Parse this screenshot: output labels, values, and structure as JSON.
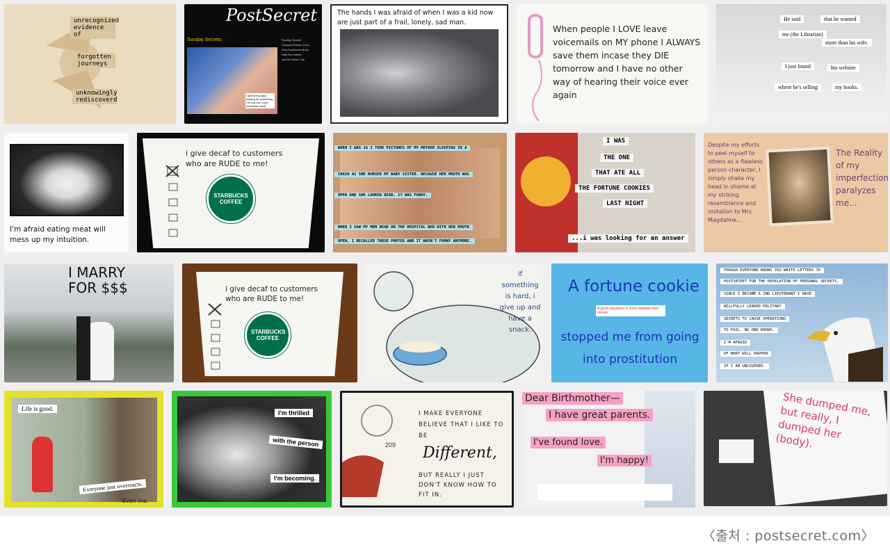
{
  "gallery": {
    "cards": [
      {
        "id": 1,
        "texts": [
          "unrecognized evidence of",
          "forgotten journeys",
          "unknowingly rediscoverd"
        ]
      },
      {
        "id": 2,
        "title": "PostSecret",
        "subtitle": "Sunday Secrets",
        "side_links": [
          "Sunday Secrets",
          "Campus Events (Tour)",
          "New PostSecret Book",
          "Help the Hotline",
          "1st the Hotline Life"
        ],
        "photo_note": "I spend my days looking for something I've lost but I can't remember what"
      },
      {
        "id": 3,
        "text": "The hands I was afraid of when I was a kid now are just part of a frail, lonely, sad man."
      },
      {
        "id": 4,
        "text": "When people I LOVE leave voicemails on MY phone I ALWAYS save them incase they DIE tomorrow and I have no other way of hearing their voice ever again"
      },
      {
        "id": 5,
        "texts": [
          "He said",
          "that he wanted",
          "me (the Librarian)",
          "more than his wife.",
          "I just found",
          "his website",
          "where he's selling",
          "my books."
        ]
      },
      {
        "id": 6,
        "text": "I'm afraid eating meat will mess up my intuition."
      },
      {
        "id": 7,
        "text": "i give decaf to customers who are RUDE to me!",
        "logo": "STARBUCKS COFFEE"
      },
      {
        "id": 8,
        "texts": [
          "WHEN I WAS 16 I TOOK PICTURES OF MY MOTHER SLEEPING IN A",
          "CHAIR AS SHE NURSED MY BABY SISTER. BECAUSE HER MOUTH WAS",
          "OPEN AND SHE LOOKED DEAD, IT WAS FUNNY.",
          "WHEN I SAW MY MOM DEAD ON THE HOSPITAL BED WITH HER MOUTH",
          "OPEN, I RECALLED THOSE PHOTOS AND IT WASN'T FUNNY ANYMORE."
        ]
      },
      {
        "id": 9,
        "texts": [
          "I WAS",
          "THE ONE",
          "THAT ATE ALL",
          "THE FORTUNE COOKIES",
          "LAST NIGHT",
          "...i was looking for an answer"
        ]
      },
      {
        "id": 10,
        "text": "Despite my efforts to peel myself to others as a flawless person character, I simply shake my head in shame at my striking resemblance and imitation to Mrs Magdaline...",
        "side": "The Reality of my imperfection paralyzes me..."
      },
      {
        "id": 11,
        "text": "I MARRY FOR $$$"
      },
      {
        "id": 12,
        "text": "i give decaf to customers who are RUDE to me!",
        "logo": "STARBUCKS COFFEE"
      },
      {
        "id": 13,
        "text": "if something is hard, i give up and have a snack."
      },
      {
        "id": 14,
        "line1": "A fortune cookie",
        "line2": "stopped me from going into prostitution",
        "slip": "A good reputation is more valuable than money"
      },
      {
        "id": 15,
        "texts": [
          "THOUGH EVERYONE KNOWS YOU WRITE LETTERS TO",
          "POSTSECRET FOR THE REVELATION OF PERSONAL SECRETS,",
          "SINCE I BECAME A 2ND LIEUTENANT I HAVE",
          "WILLFULLY LEAKED MILITARY",
          "SECRETS TO CAUSE OPERATIONS",
          "TO FAIL. NO ONE KNOWS.",
          "I'M AFRAID",
          "OF WHAT WILL HAPPEN",
          "IF I AM UNCOVERED."
        ]
      },
      {
        "id": 16,
        "texts": [
          "Life is good.",
          "Everyone just overreacts.",
          "Even me."
        ]
      },
      {
        "id": 17,
        "texts": [
          "I'm thrilled",
          "with the person",
          "I'm becoming."
        ]
      },
      {
        "id": 18,
        "text": "I MAKE EVERYONE BELIEVE THAT I LIKE TO BE",
        "big": "Different,",
        "text2": "BUT REALLY I JUST DON'T KNOW HOW TO FIT IN.",
        "stamp": "209"
      },
      {
        "id": 19,
        "texts": [
          "Dear Birthmother—",
          "I have great parents.",
          "I've found love.",
          "I'm happy!"
        ]
      },
      {
        "id": 20,
        "text": "She dumped me, but really, I dumped her (body)."
      }
    ]
  },
  "source": "〈출처 : postsecret.com〉",
  "colors": {
    "background": "#efefef",
    "starbucks_green": "#00704a",
    "fortune_blue": "#1d33b8"
  }
}
